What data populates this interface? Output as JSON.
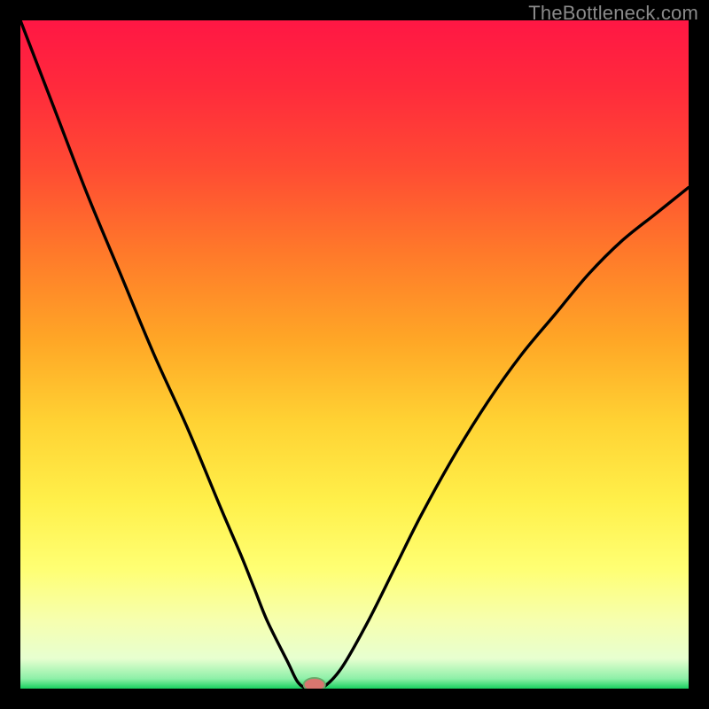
{
  "watermark": "TheBottleneck.com",
  "colors": {
    "frame": "#000000",
    "watermark_text": "#8a8a8a",
    "curve": "#000000",
    "marker_fill": "#d8766f",
    "marker_stroke": "#6aa86a",
    "gradient_stops": [
      {
        "offset": 0.0,
        "color": "#ff1744"
      },
      {
        "offset": 0.1,
        "color": "#ff2a3c"
      },
      {
        "offset": 0.22,
        "color": "#ff4b33"
      },
      {
        "offset": 0.35,
        "color": "#ff7a2a"
      },
      {
        "offset": 0.48,
        "color": "#ffa726"
      },
      {
        "offset": 0.6,
        "color": "#ffd233"
      },
      {
        "offset": 0.72,
        "color": "#fff04a"
      },
      {
        "offset": 0.82,
        "color": "#ffff73"
      },
      {
        "offset": 0.9,
        "color": "#f6ffb0"
      },
      {
        "offset": 0.955,
        "color": "#e7ffd0"
      },
      {
        "offset": 0.985,
        "color": "#8ef0a8"
      },
      {
        "offset": 1.0,
        "color": "#18d060"
      }
    ]
  },
  "chart_data": {
    "type": "line",
    "title": "",
    "xlabel": "",
    "ylabel": "",
    "xlim": [
      0,
      100
    ],
    "ylim": [
      0,
      100
    ],
    "series": [
      {
        "name": "bottleneck-curve",
        "x": [
          0,
          5,
          10,
          15,
          20,
          25,
          30,
          33,
          35,
          37,
          40,
          41.5,
          43,
          45,
          48,
          52,
          56,
          60,
          65,
          70,
          75,
          80,
          85,
          90,
          95,
          100
        ],
        "y": [
          100,
          87,
          74,
          62,
          50,
          39,
          27,
          20,
          15,
          10,
          4,
          1,
          0,
          0,
          3,
          10,
          18,
          26,
          35,
          43,
          50,
          56,
          62,
          67,
          71,
          75
        ]
      }
    ],
    "marker": {
      "x": 44,
      "y": 0,
      "rx": 1.6,
      "ry": 1.0
    },
    "background": "vertical-rainbow-gradient"
  }
}
